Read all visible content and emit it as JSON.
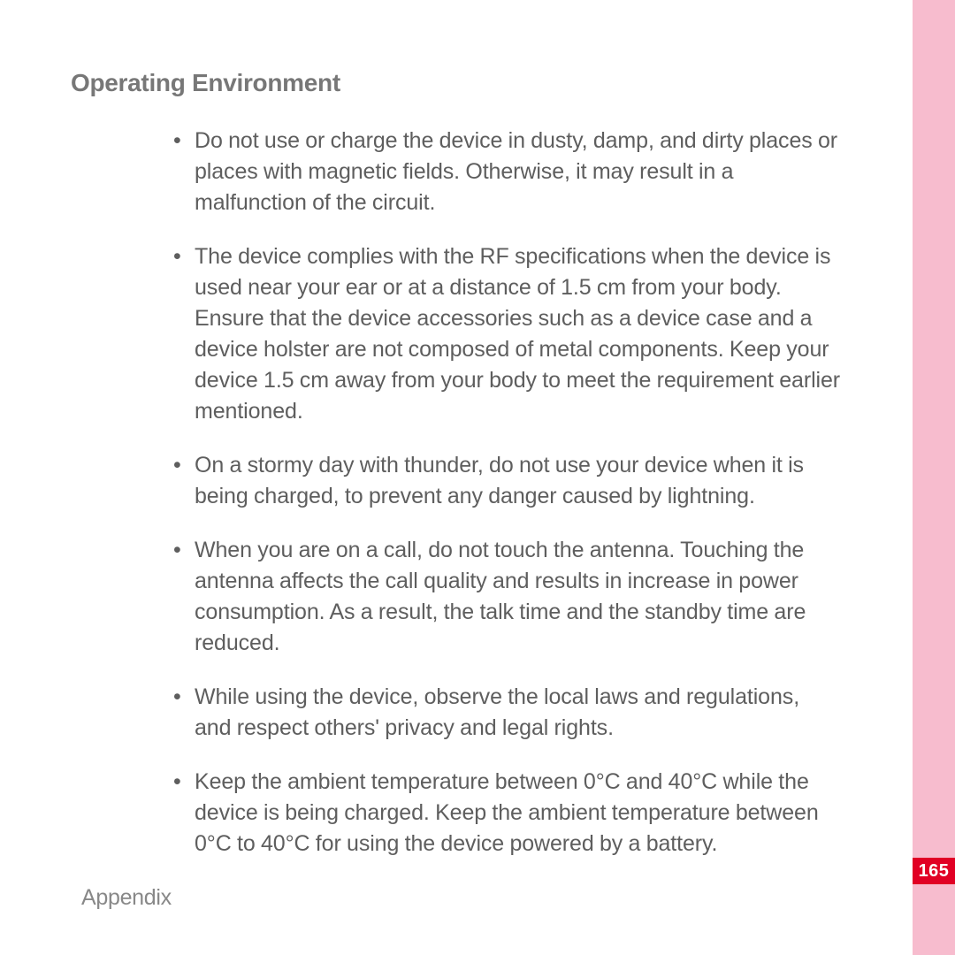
{
  "heading": "Operating Environment",
  "bullets": [
    "Do not use or charge the device in dusty, damp, and dirty places or places with magnetic fields. Otherwise, it may result in a malfunction of the circuit.",
    "The device complies with the RF specifications when the device is used near your ear or at a distance of 1.5 cm from your body. Ensure that the device accessories such as a device case and a device holster are not composed of metal components. Keep your device 1.5 cm away from your body to meet the requirement earlier mentioned.",
    "On a stormy day with thunder, do not use your device when it is being charged, to prevent any danger caused by lightning.",
    "When you are on a call, do not touch the antenna. Touching the antenna affects the call quality and results in increase in power consumption. As a result, the talk time and the standby time are reduced.",
    "While using the device, observe the local laws and regulations, and respect others' privacy and legal rights.",
    "Keep the ambient temperature between 0°C and 40°C while the device is being charged. Keep the ambient temperature between 0°C to 40°C for using the device powered by a battery."
  ],
  "footer": "Appendix",
  "page_number": "165"
}
